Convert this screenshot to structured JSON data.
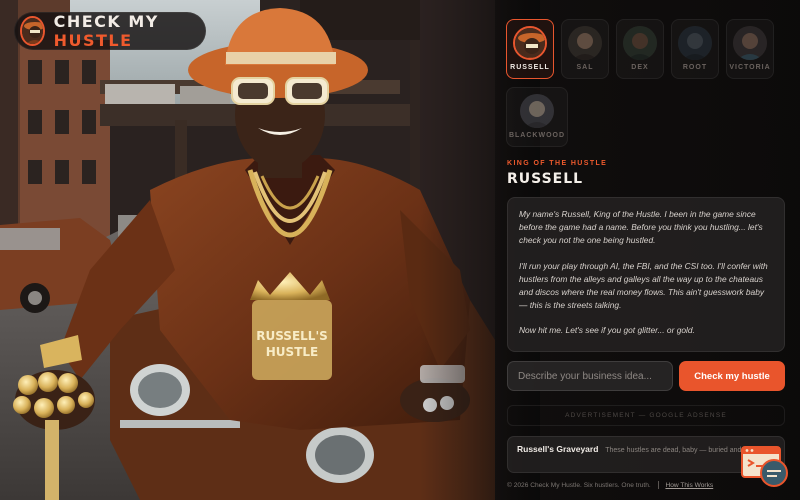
{
  "app": {
    "logo_prefix": "CHECK MY ",
    "logo_accent": "HUSTLE",
    "accent_color": "#e9552c"
  },
  "characters": [
    {
      "name": "RUSSELL",
      "active": true
    },
    {
      "name": "SAL",
      "active": false
    },
    {
      "name": "DEX",
      "active": false
    },
    {
      "name": "ROOT",
      "active": false
    },
    {
      "name": "VICTORIA",
      "active": false
    },
    {
      "name": "BLACKWOOD",
      "active": false
    }
  ],
  "profile": {
    "subtitle": "KING OF THE HUSTLE",
    "name": "RUSSELL",
    "bio": [
      "My name's Russell, King of the Hustle. I been in the game since before the game had a name. Before you think you hustling... let's check you not the one being hustled.",
      "I'll run your play through AI, the FBI, and the CSI too. I'll confer with hustlers from the alleys and galleys all the way up to the chateaus and discos where the real money flows. This ain't guesswork baby — this is the streets talking.",
      "Now hit me. Let's see if you got glitter... or gold."
    ]
  },
  "form": {
    "input_placeholder": "Describe your business idea...",
    "submit_label": "Check my hustle"
  },
  "ad": {
    "label": "ADVERTISEMENT — GOOGLE ADSENSE"
  },
  "graveyard": {
    "title": "Russell's Graveyard",
    "text": "These hustles are dead, baby — buried and gone"
  },
  "footer": {
    "copyright": "© 2026 Check My Hustle. Six hustlers. One truth.",
    "link": "How This Works"
  },
  "medallion": {
    "line1": "RUSSELL'S",
    "line2": "HUSTLE"
  },
  "icons": [
    "avatar-russell",
    "fire-icon",
    "chat-widget-icon"
  ]
}
